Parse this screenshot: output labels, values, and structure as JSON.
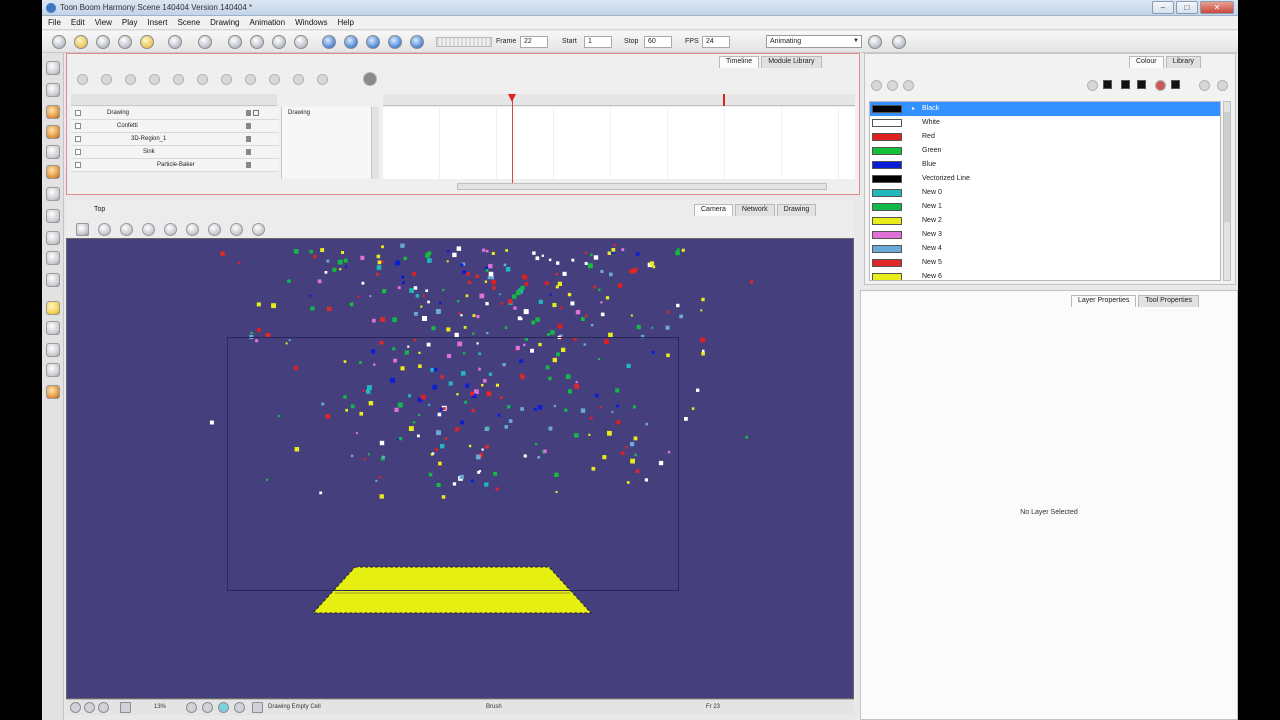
{
  "window": {
    "title": "Toon Boom Harmony Scene 140404 Version 140404 *"
  },
  "menu": [
    "File",
    "Edit",
    "View",
    "Play",
    "Insert",
    "Scene",
    "Drawing",
    "Animation",
    "Windows",
    "Help"
  ],
  "toolbar": {
    "frame_label": "Frame",
    "frame_value": "22",
    "start_label": "Start",
    "start_value": "1",
    "stop_label": "Stop",
    "stop_value": "60",
    "fps_label": "FPS",
    "fps_value": "24",
    "workspace": "Animating"
  },
  "timeline": {
    "tabs": [
      "Timeline",
      "Module Library"
    ],
    "layers": [
      {
        "name": "Drawing",
        "indent": 0
      },
      {
        "name": "Confetti",
        "indent": 0
      },
      {
        "name": "3D-Region_1",
        "indent": 1
      },
      {
        "name": "Sink",
        "indent": 2
      },
      {
        "name": "Particle-Baker",
        "indent": 3
      }
    ],
    "column_name": "Drawing"
  },
  "view": {
    "title": "Top",
    "tabs": [
      "Camera",
      "Network",
      "Drawing"
    ],
    "footer": {
      "zoom": "13%",
      "status": "Drawing Empty Cell",
      "tool": "Brush",
      "frame": "Fr 23"
    }
  },
  "colour_panel": {
    "tabs": [
      "Colour",
      "Library"
    ],
    "swatches": [
      {
        "name": "Black",
        "color": "#000000",
        "selected": true
      },
      {
        "name": "White",
        "color": "#ffffff"
      },
      {
        "name": "Red",
        "color": "#e02020"
      },
      {
        "name": "Green",
        "color": "#12c03a"
      },
      {
        "name": "Blue",
        "color": "#0a1ed6"
      },
      {
        "name": "Vectorized Line",
        "color": "#000000"
      },
      {
        "name": "New 0",
        "color": "#20b8b8"
      },
      {
        "name": "New 1",
        "color": "#12b84a"
      },
      {
        "name": "New 2",
        "color": "#e8ec1c"
      },
      {
        "name": "New 3",
        "color": "#e070d8"
      },
      {
        "name": "New 4",
        "color": "#6aaad8"
      },
      {
        "name": "New 5",
        "color": "#e02828"
      },
      {
        "name": "New 6",
        "color": "#e8ec1c"
      }
    ]
  },
  "properties_panel": {
    "tabs": [
      "Layer Properties",
      "Tool Properties"
    ],
    "message": "No Layer Selected"
  },
  "scene_colors": {
    "background": "#463f7d",
    "floor": "#e6ef12"
  }
}
